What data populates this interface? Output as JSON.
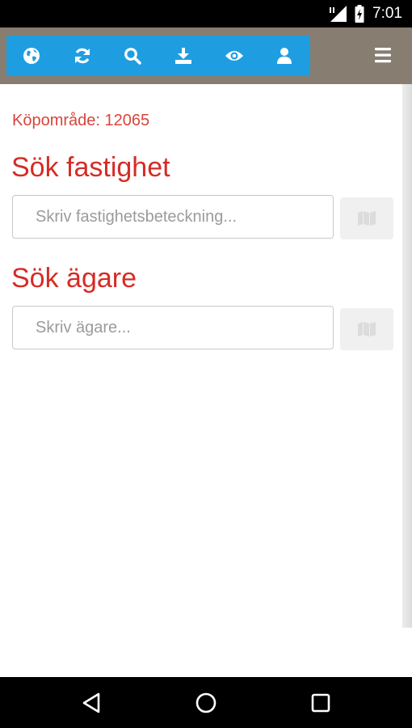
{
  "status_bar": {
    "time": "7:01"
  },
  "toolbar": {
    "icons": [
      "globe-icon",
      "refresh-icon",
      "search-icon",
      "download-icon",
      "eye-icon",
      "user-icon"
    ],
    "accent_color": "#1e9ee0",
    "header_color": "#877d71"
  },
  "main": {
    "area_label": "Köpområde: 12065",
    "property_search": {
      "title": "Sök fastighet",
      "placeholder": "Skriv fastighetsbeteckning..."
    },
    "owner_search": {
      "title": "Sök ägare",
      "placeholder": "Skriv ägare..."
    },
    "title_color": "#d62b25"
  }
}
